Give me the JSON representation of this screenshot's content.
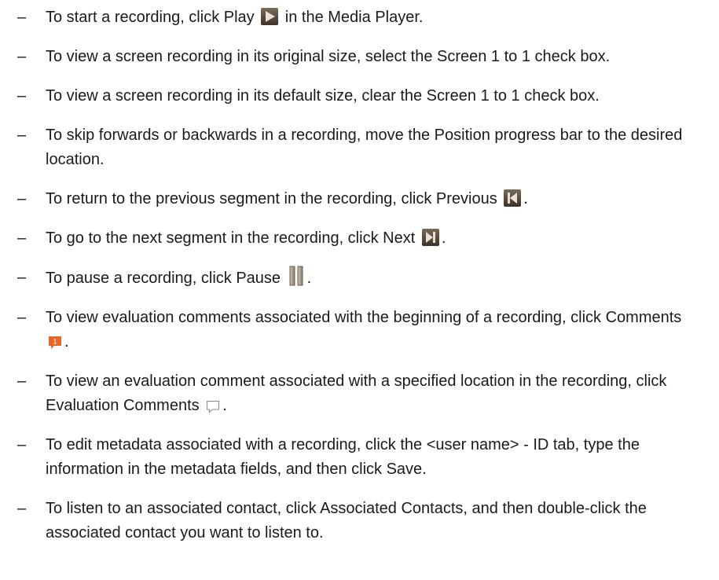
{
  "bullet": "–",
  "items": [
    {
      "before": "To start a recording, click Play ",
      "icon": "play-icon",
      "after": " in the Media Player."
    },
    {
      "before": "To view a screen recording in its original size, select the Screen 1 to 1 check box.",
      "icon": null,
      "after": ""
    },
    {
      "before": "To view a screen recording in its default size, clear the Screen 1 to 1 check box.",
      "icon": null,
      "after": ""
    },
    {
      "before": "To skip forwards or backwards in a recording, move the Position progress bar to the desired location.",
      "icon": null,
      "after": ""
    },
    {
      "before": "To return to the previous segment in the recording, click Previous ",
      "icon": "previous-icon",
      "after": "."
    },
    {
      "before": "To go to the next segment in the recording, click Next ",
      "icon": "next-icon",
      "after": "."
    },
    {
      "before": "To pause a recording, click Pause ",
      "icon": "pause-icon",
      "after": "."
    },
    {
      "before": "To view evaluation comments associated with the beginning of a recording, click Comments ",
      "icon": "comments-icon",
      "after": "."
    },
    {
      "before": "To view an evaluation comment associated with a specified location in the recording, click Evaluation Comments ",
      "icon": "evaluation-comments-icon",
      "after": "."
    },
    {
      "before": "To edit metadata associated with a recording, click the <user name> - ID tab, type the information in the metadata fields, and then click Save.",
      "icon": null,
      "after": ""
    },
    {
      "before": "To listen to an associated contact, click Associated Contacts, and then double-click the associated contact you want to listen to.",
      "icon": null,
      "after": ""
    }
  ],
  "icon_badge_text": "1",
  "colors": {
    "text": "#1a1a1a",
    "media_button_dark": "#5a4a3a",
    "media_button_light": "#d8d0c4",
    "comment_orange": "#e8662c"
  }
}
